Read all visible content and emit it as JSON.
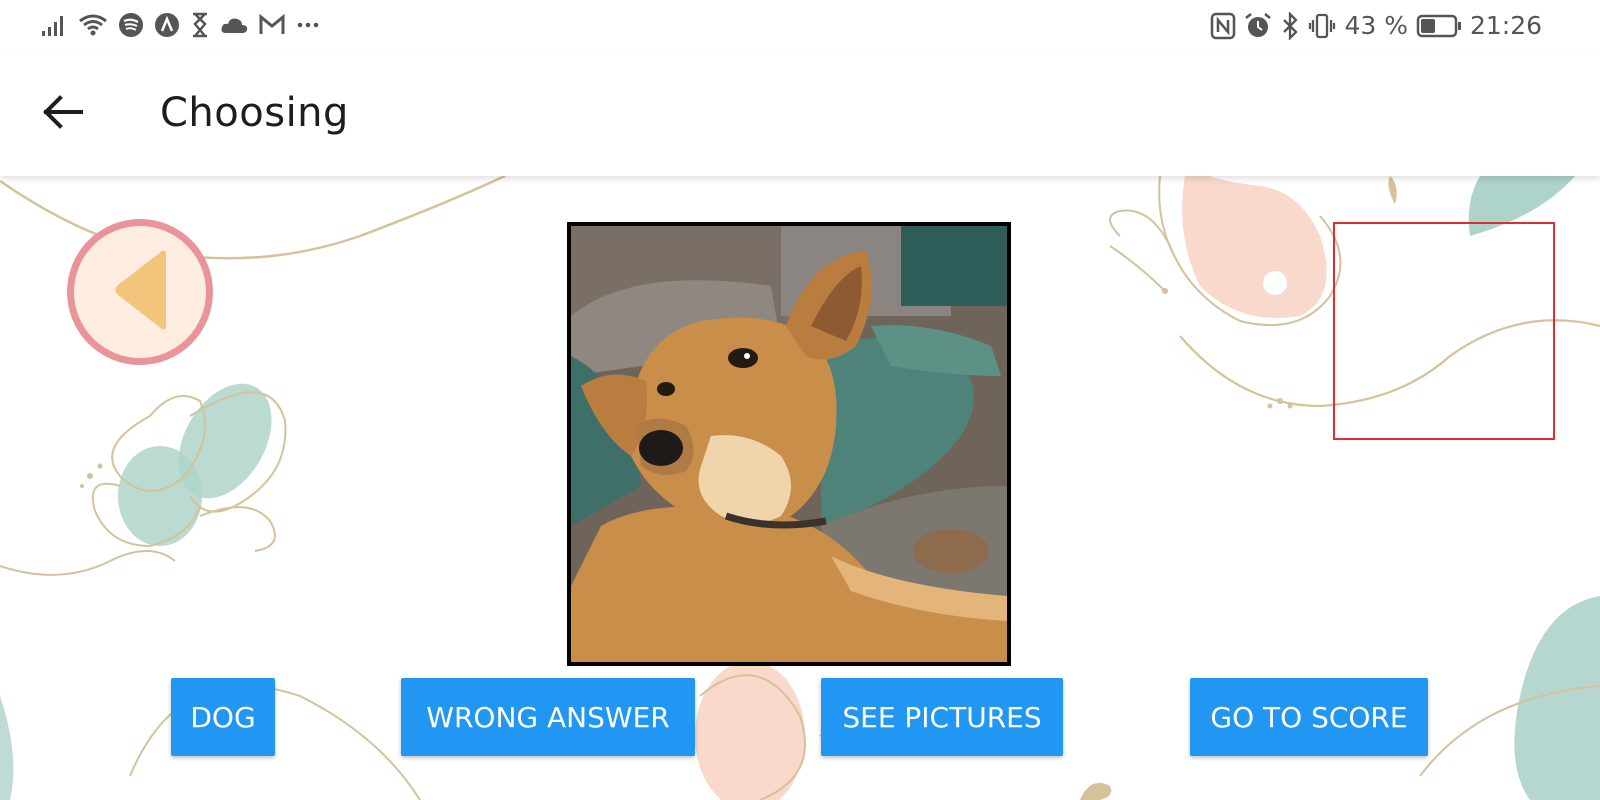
{
  "status_bar": {
    "left_icons": [
      "signal-icon",
      "wifi-icon",
      "spotify-icon",
      "app-logo-icon",
      "hourglass-icon",
      "cloud-icon",
      "gmail-icon",
      "more-dots-icon"
    ],
    "right_icons": [
      "nfc-icon",
      "alarm-icon",
      "bluetooth-icon",
      "vibrate-icon"
    ],
    "battery_text": "43 %",
    "battery_level": 0.43,
    "time": "21:26"
  },
  "app_bar": {
    "title": "Choosing",
    "back_icon": "arrow-left-icon"
  },
  "main": {
    "prev_icon": "triangle-left-icon",
    "photo_description": "dog-photo",
    "buttons": {
      "dog": "DOG",
      "wrong_answer": "WRONG ANSWER",
      "see_pictures": "SEE PICTURES",
      "go_to_score": "GO TO SCORE"
    }
  },
  "colors": {
    "button_blue": "#2196f3",
    "prev_ring": "#e9939a",
    "prev_fill": "#fdece0",
    "prev_triangle": "#f3c57c",
    "target_border": "#e32c2c"
  }
}
